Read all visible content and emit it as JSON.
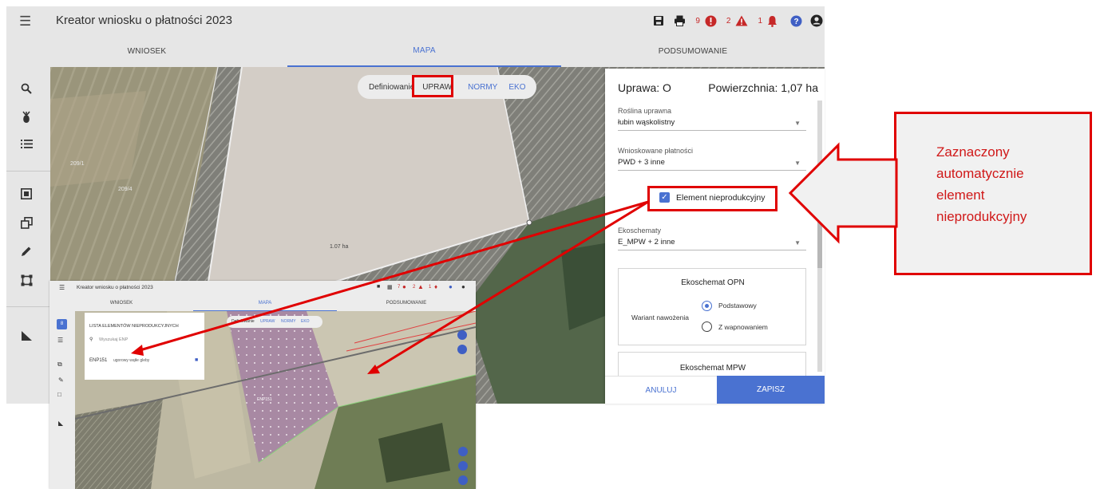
{
  "app": {
    "title": "Kreator wniosku o płatności 2023",
    "counts": {
      "errors": "9",
      "warnings": "2",
      "notifications": "1"
    },
    "icons": [
      "menu-icon",
      "save-icon",
      "print-icon",
      "error-icon",
      "warning-icon",
      "bell-icon",
      "help-icon",
      "account-icon"
    ],
    "colors": {
      "accent": "#4a72d1",
      "error": "#c62828",
      "highlight": "#e00000"
    }
  },
  "tabs": [
    {
      "label": "WNIOSEK",
      "active": false
    },
    {
      "label": "MAPA",
      "active": true
    },
    {
      "label": "PODSUMOWANIE",
      "active": false
    }
  ],
  "sidebar": [
    "search-icon",
    "crop-icon",
    "list-icon",
    "element-icon",
    "layers-icon",
    "pencil-icon",
    "select-icon",
    "measure-icon"
  ],
  "map": {
    "definition_label": "Definiowanie",
    "modes": [
      {
        "label": "UPRAW",
        "selected": true
      },
      {
        "label": "NORMY",
        "selected": false
      },
      {
        "label": "EKO",
        "selected": false
      }
    ],
    "parcel_labels": [
      "209/1",
      "209/4",
      "1.07 ha"
    ]
  },
  "panel": {
    "crop": "Uprawa: O",
    "area": "Powierzchnia: 1,07 ha",
    "plant_label": "Roślina uprawna",
    "plant_value": "łubin wąskolistny",
    "payments_label": "Wnioskowane płatności",
    "payments_value": "PWD + 3 inne",
    "non_productive_label": "Element nieprodukcyjny",
    "non_productive_checked": true,
    "eco_label": "Ekoschematy",
    "eco_value": "E_MPW + 2 inne",
    "opn": {
      "title": "Ekoschemat OPN",
      "variant_label": "Wariant nawożenia",
      "options": [
        {
          "label": "Podstawowy",
          "selected": true
        },
        {
          "label": "Z wapnowaniem",
          "selected": false
        }
      ]
    },
    "mpw_title": "Ekoschemat MPW",
    "cancel": "ANULUJ",
    "save": "ZAPISZ"
  },
  "callout": {
    "lines": [
      "Zaznaczony",
      "automatycznie",
      "element",
      "nieprodukcyjny"
    ]
  },
  "inset": {
    "title": "Kreator wniosku o płatności 2023",
    "counts": {
      "errors": "7",
      "warnings": "2",
      "notifications": "1"
    },
    "tabs": [
      "WNIOSEK",
      "MAPA",
      "PODSUMOWANIE"
    ],
    "list_title": "LISTA ELEMENTÓW NIEPRODUKCYJNYCH",
    "search_placeholder": "Wyszukaj ENP",
    "item_id": "ENP151",
    "item_desc": "ugorowy wątłe gleby",
    "definition_label": "Definiowanie",
    "modes": [
      "UPRAW",
      "NORMY",
      "EKO"
    ],
    "parcel_label": "ENP151"
  }
}
